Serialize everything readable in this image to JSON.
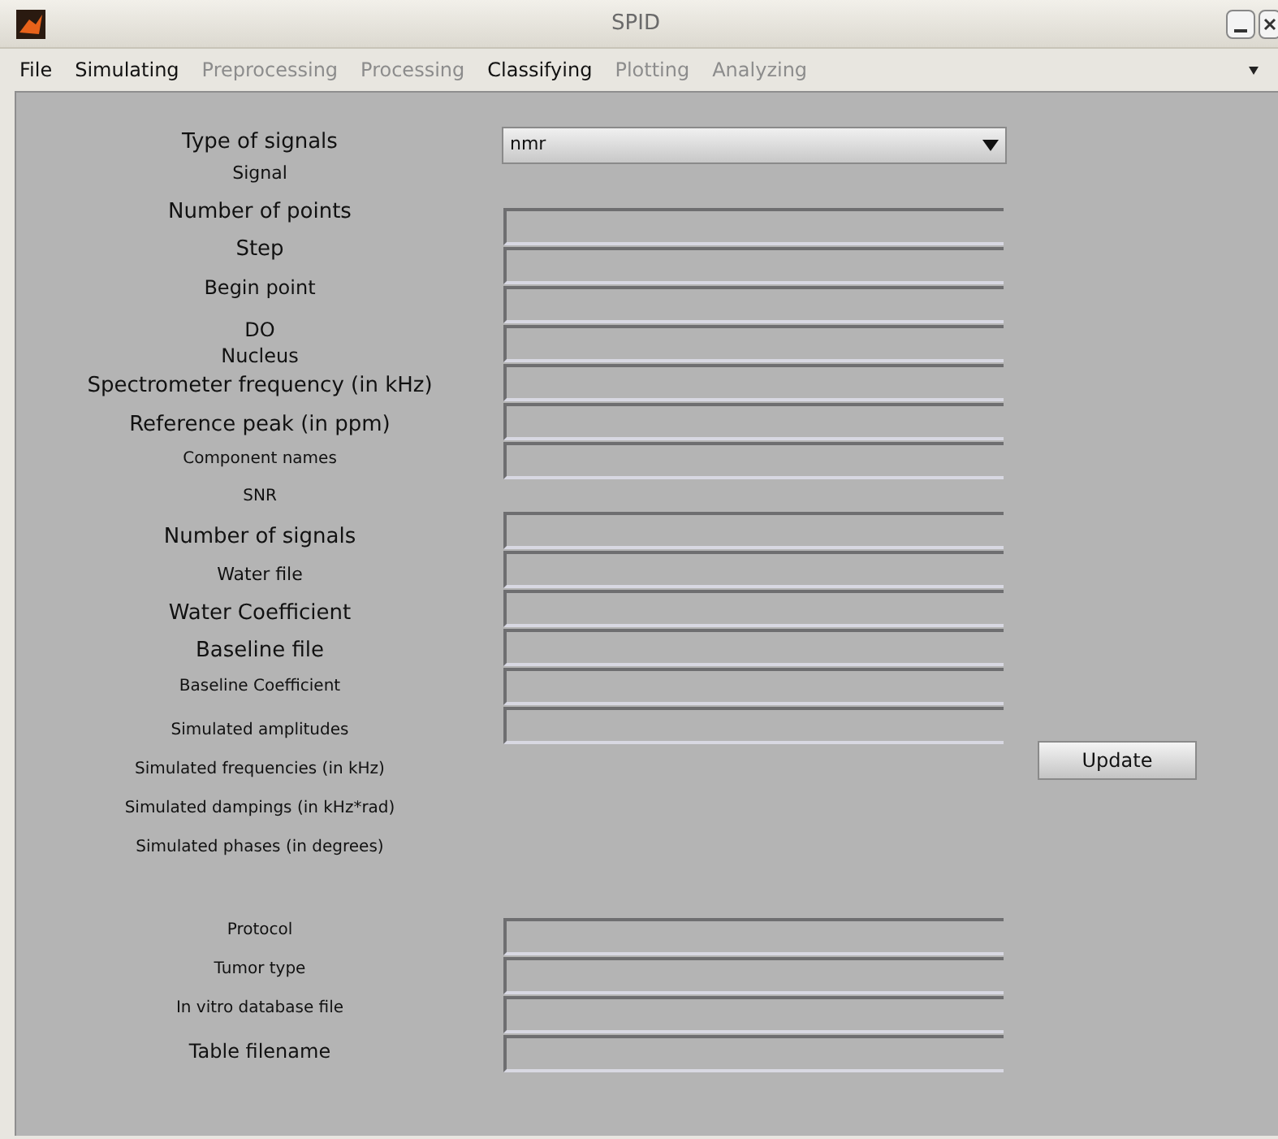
{
  "window": {
    "title": "SPID"
  },
  "menu": [
    {
      "label": "File",
      "disabled": false
    },
    {
      "label": "Simulating",
      "disabled": false
    },
    {
      "label": "Preprocessing",
      "disabled": true
    },
    {
      "label": "Processing",
      "disabled": true
    },
    {
      "label": "Classifying",
      "disabled": false
    },
    {
      "label": "Plotting",
      "disabled": true
    },
    {
      "label": "Analyzing",
      "disabled": true
    }
  ],
  "signal_type": {
    "value": "nmr"
  },
  "labels": [
    "Type of signals",
    "Signal",
    "Number of points",
    "Step",
    "Begin point",
    "DO",
    "Nucleus",
    "Spectrometer frequency (in kHz)",
    "Reference peak (in ppm)",
    "Component names",
    "SNR",
    "Number of signals",
    "Water file",
    "Water Coefficient",
    "Baseline file",
    "Baseline Coefficient",
    "Simulated amplitudes",
    "Simulated frequencies (in kHz)",
    "Simulated dampings (in kHz*rad)",
    "Simulated phases (in degrees)",
    "Protocol",
    "Tumor type",
    "In vitro database file",
    "Table filename"
  ],
  "update_button": "Update"
}
